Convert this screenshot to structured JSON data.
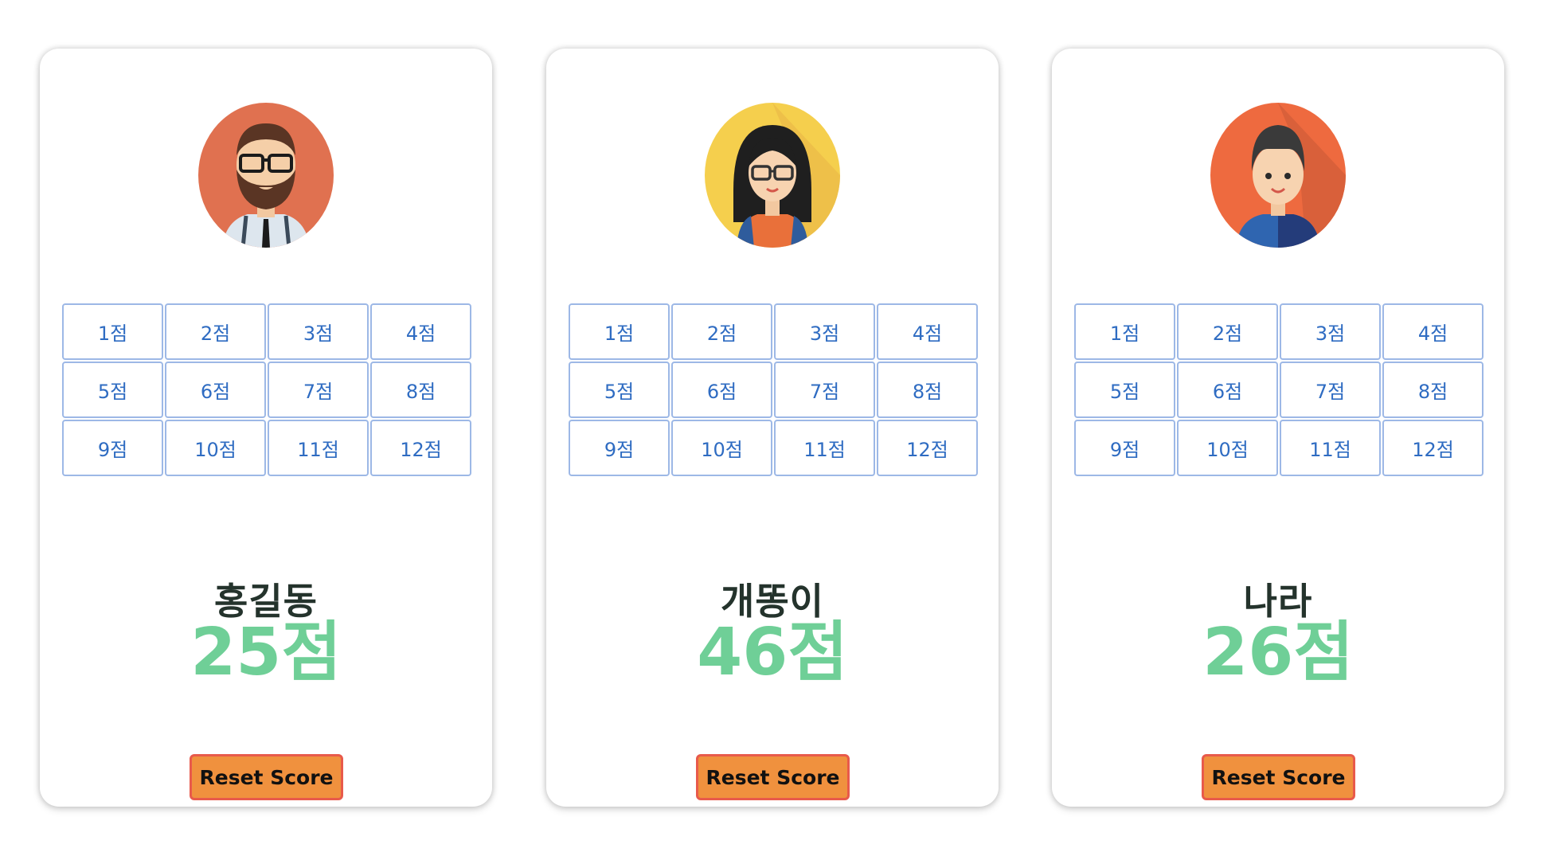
{
  "score_buttons": [
    "1점",
    "2점",
    "3점",
    "4점",
    "5점",
    "6점",
    "7점",
    "8점",
    "9점",
    "10점",
    "11점",
    "12점"
  ],
  "reset_label": "Reset Score",
  "players": [
    {
      "name": "홍길동",
      "score": "25점",
      "avatar": "bearded-man-avatar-icon",
      "avatar_bg": "#e07150"
    },
    {
      "name": "개똥이",
      "score": "46점",
      "avatar": "woman-glasses-avatar-icon",
      "avatar_bg": "#f5cf4d"
    },
    {
      "name": "나라",
      "score": "26점",
      "avatar": "boy-avatar-icon",
      "avatar_bg": "#ee6a3f"
    }
  ],
  "colors": {
    "score_text": "#6fcf97",
    "name_text": "#24332c",
    "button_border": "#9db8e6",
    "button_text": "#2f6cc2",
    "reset_bg": "#f0913e",
    "reset_border": "#e85a4b"
  }
}
